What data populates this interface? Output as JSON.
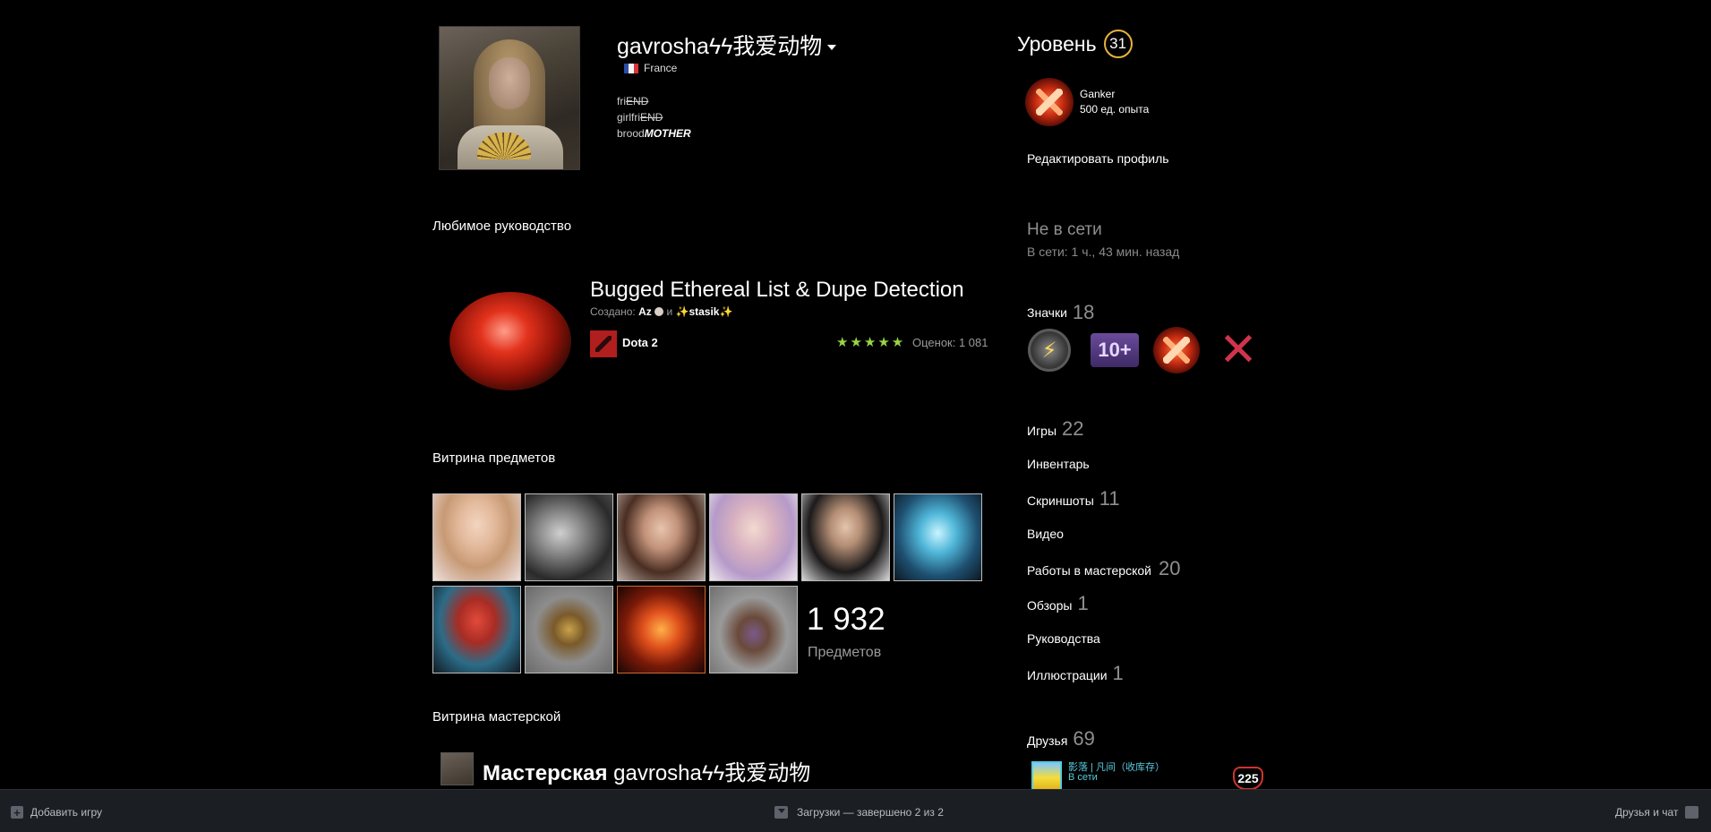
{
  "profile": {
    "persona_name": "gavroshaϟϟ我爱动物",
    "country": "France",
    "summary": {
      "line1_prefix": "fri",
      "line1_strike": "END",
      "line2_prefix": "girlfri",
      "line2_strike": "END",
      "line3_prefix": "brood",
      "line3_bold": "MOTHER"
    }
  },
  "level": {
    "label": "Уровень",
    "value": "31"
  },
  "favorite_badge": {
    "name": "Ganker",
    "xp": "500 ед. опыта"
  },
  "edit_profile_label": "Редактировать профиль",
  "status": {
    "state": "Не в сети",
    "last_online": "В сети: 1 ч., 43 мин. назад"
  },
  "badges": {
    "label": "Значки",
    "count": "18",
    "icons": [
      "lightning-badge-icon",
      "years-of-service-badge-icon",
      "dota-emblem-badge-icon",
      "red-x-badge-icon"
    ],
    "ten_plus_text": "10+"
  },
  "sidebar_links": [
    {
      "label": "Игры",
      "count": "22"
    },
    {
      "label": "Инвентарь",
      "count": ""
    },
    {
      "label": "Скриншоты",
      "count": "11"
    },
    {
      "label": "Видео",
      "count": ""
    },
    {
      "label": "Работы в мастерской",
      "count": "20"
    },
    {
      "label": "Обзоры",
      "count": "1"
    },
    {
      "label": "Руководства",
      "count": ""
    },
    {
      "label": "Иллюстрации",
      "count": "1"
    }
  ],
  "friends": {
    "label": "Друзья",
    "count": "69",
    "first_friend": {
      "name": "影落 | 凡间（收库存）",
      "status": "В сети",
      "level": "225"
    }
  },
  "favorite_guide": {
    "section_title": "Любимое руководство",
    "title": "Bugged Ethereal List & Dupe Detection",
    "created_label": "Создано:",
    "author1": "Az",
    "and_label": "и",
    "author2": "✨stasik✨",
    "app_name": "Dota 2",
    "stars": "★★★★★",
    "rating": "Оценок: 1 081"
  },
  "item_showcase": {
    "section_title": "Витрина предметов",
    "count": "1 932",
    "count_label": "Предметов"
  },
  "workshop_showcase": {
    "section_title": "Витрина мастерской",
    "title_prefix": "Мастерская",
    "title_name": "gavroshaϟϟ我爱动物"
  },
  "bottom_bar": {
    "add_game": "Добавить игру",
    "downloads": "Загрузки — завершено 2 из 2",
    "friends_chat": "Друзья и чат"
  },
  "colors": {
    "level_ring": "#e7b33c",
    "online_blue": "#57cbde",
    "star_green": "#9ad444",
    "muted_gray": "#8f8f8f",
    "bottom_bar_bg": "#1b1f24"
  }
}
